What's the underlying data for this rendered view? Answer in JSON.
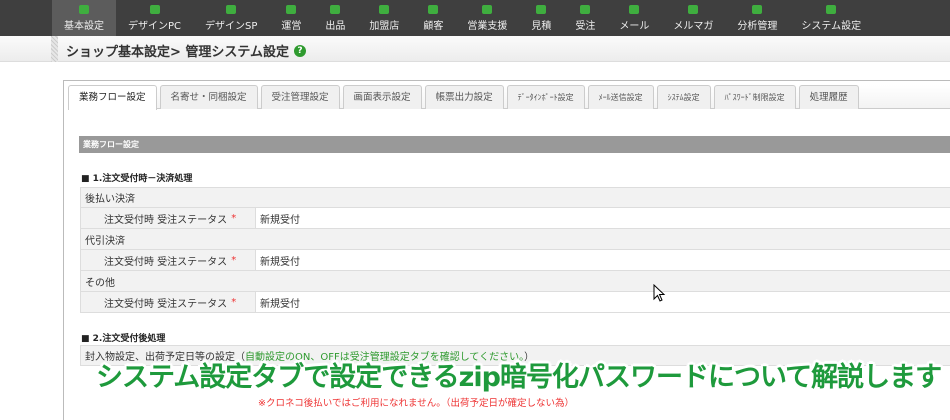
{
  "nav": {
    "items": [
      {
        "label": "基本設定",
        "active": true
      },
      {
        "label": "デザインPC"
      },
      {
        "label": "デザインSP"
      },
      {
        "label": "運営"
      },
      {
        "label": "出品"
      },
      {
        "label": "加盟店"
      },
      {
        "label": "顧客"
      },
      {
        "label": "営業支援"
      },
      {
        "label": "見積"
      },
      {
        "label": "受注"
      },
      {
        "label": "メール"
      },
      {
        "label": "メルマガ"
      },
      {
        "label": "分析管理"
      },
      {
        "label": "システム設定"
      }
    ]
  },
  "header": {
    "title": "ショップ基本設定> 管理システム設定",
    "help_icon": "?"
  },
  "tabs": [
    "業務フロー設定",
    "名寄せ・同梱設定",
    "受注管理設定",
    "画面表示設定",
    "帳票出力設定",
    "ﾃﾞｰﾀｲﾝﾎﾟｰﾄ設定",
    "ﾒｰﾙ送信設定",
    "ｼｽﾃﾑ設定",
    "ﾊﾟｽﾜｰﾄﾞ制限設定",
    "処理履歴"
  ],
  "section_header": "業務フロー設定",
  "section1": {
    "title": "■ 1.注文受付時－決済処理",
    "groups": [
      {
        "name": "後払い決済",
        "label": "注文受付時 受注ステータス",
        "required": "*",
        "value": "新規受付"
      },
      {
        "name": "代引決済",
        "label": "注文受付時 受注ステータス",
        "required": "*",
        "value": "新規受付"
      },
      {
        "name": "その他",
        "label": "注文受付時 受注ステータス",
        "required": "*",
        "value": "新規受付"
      }
    ]
  },
  "section2": {
    "title": "■ 2.注文受付後処理",
    "row_label": "封入物設定、出荷予定日等の設定（",
    "row_note": "自動設定のON、OFFは受注管理設定タブを確認してください。",
    "row_end": "）",
    "red_note": "※クロネコ後払いではご利用になれません。（出荷予定日が確定しない為）"
  },
  "caption": "システム設定タブで設定できるzip暗号化パスワードについて解説します"
}
